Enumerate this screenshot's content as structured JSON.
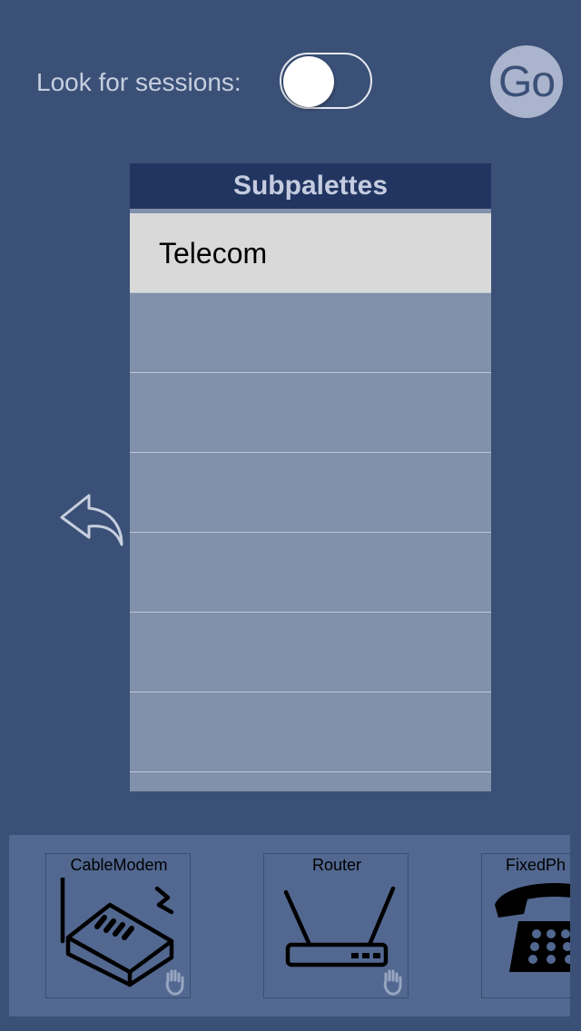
{
  "header": {
    "look_for_sessions_label": "Look for sessions:",
    "toggle_on": false,
    "go_label": "Go"
  },
  "subpalettes": {
    "title": "Subpalettes",
    "items": [
      "Telecom",
      "",
      "",
      "",
      "",
      "",
      "",
      ""
    ],
    "selected_index": 0
  },
  "palette": {
    "items": [
      {
        "label": "CableModem",
        "icon": "cable-modem-icon"
      },
      {
        "label": "Router",
        "icon": "router-icon"
      },
      {
        "label": "FixedPh",
        "icon": "fixed-phone-icon"
      }
    ]
  },
  "colors": {
    "background": "#3b5077",
    "list_header": "#213560",
    "list_body": "#8190ab",
    "selected_row": "#d9d9d9",
    "palette_bar": "#526890"
  }
}
